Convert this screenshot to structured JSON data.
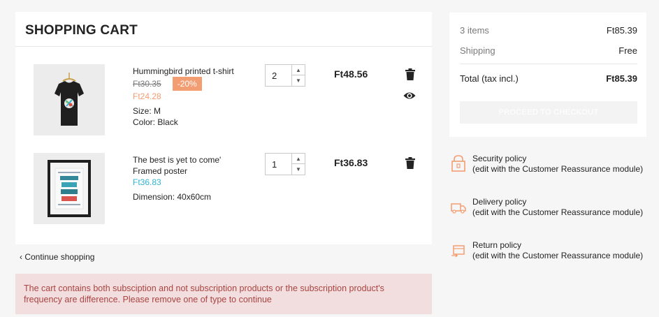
{
  "cart": {
    "title": "SHOPPING CART",
    "items": [
      {
        "name": "Hummingbird printed t-shirt",
        "regular_price": "Ft30.35",
        "discount": "-20%",
        "price": "Ft24.28",
        "attributes": [
          {
            "label": "Size",
            "value": "M",
            "text": "Size: M"
          },
          {
            "label": "Color",
            "value": "Black",
            "text": "Color: Black"
          }
        ],
        "quantity": "2",
        "total": "Ft48.56"
      },
      {
        "name_line1": "The best is yet to come'",
        "name_line2": "Framed poster",
        "price": "Ft36.83",
        "attributes": [
          {
            "label": "Dimension",
            "value": "40x60cm",
            "text": "Dimension: 40x60cm"
          }
        ],
        "quantity": "1",
        "total": "Ft36.83"
      }
    ],
    "continue_label": "Continue shopping",
    "alert": "The cart contains both subsciption and not subscription products or the subscription product's frequency are difference. Please remove one of type to continue"
  },
  "summary": {
    "items_label": "3 items",
    "items_value": "Ft85.39",
    "shipping_label": "Shipping",
    "shipping_value": "Free",
    "total_label": "Total (tax incl.)",
    "total_value": "Ft85.39",
    "checkout_label": "PROCEED TO CHECKOUT"
  },
  "reassurance": [
    {
      "title": "Security policy",
      "desc": "(edit with the Customer Reassurance module)",
      "icon": "shield-lock-icon"
    },
    {
      "title": "Delivery policy",
      "desc": "(edit with the Customer Reassurance module)",
      "icon": "truck-icon"
    },
    {
      "title": "Return policy",
      "desc": "(edit with the Customer Reassurance module)",
      "icon": "return-box-icon"
    }
  ],
  "colors": {
    "accent": "#2fb5d2",
    "discount": "#f39d72",
    "alert_bg": "#f2dede",
    "alert_text": "#a94442"
  }
}
